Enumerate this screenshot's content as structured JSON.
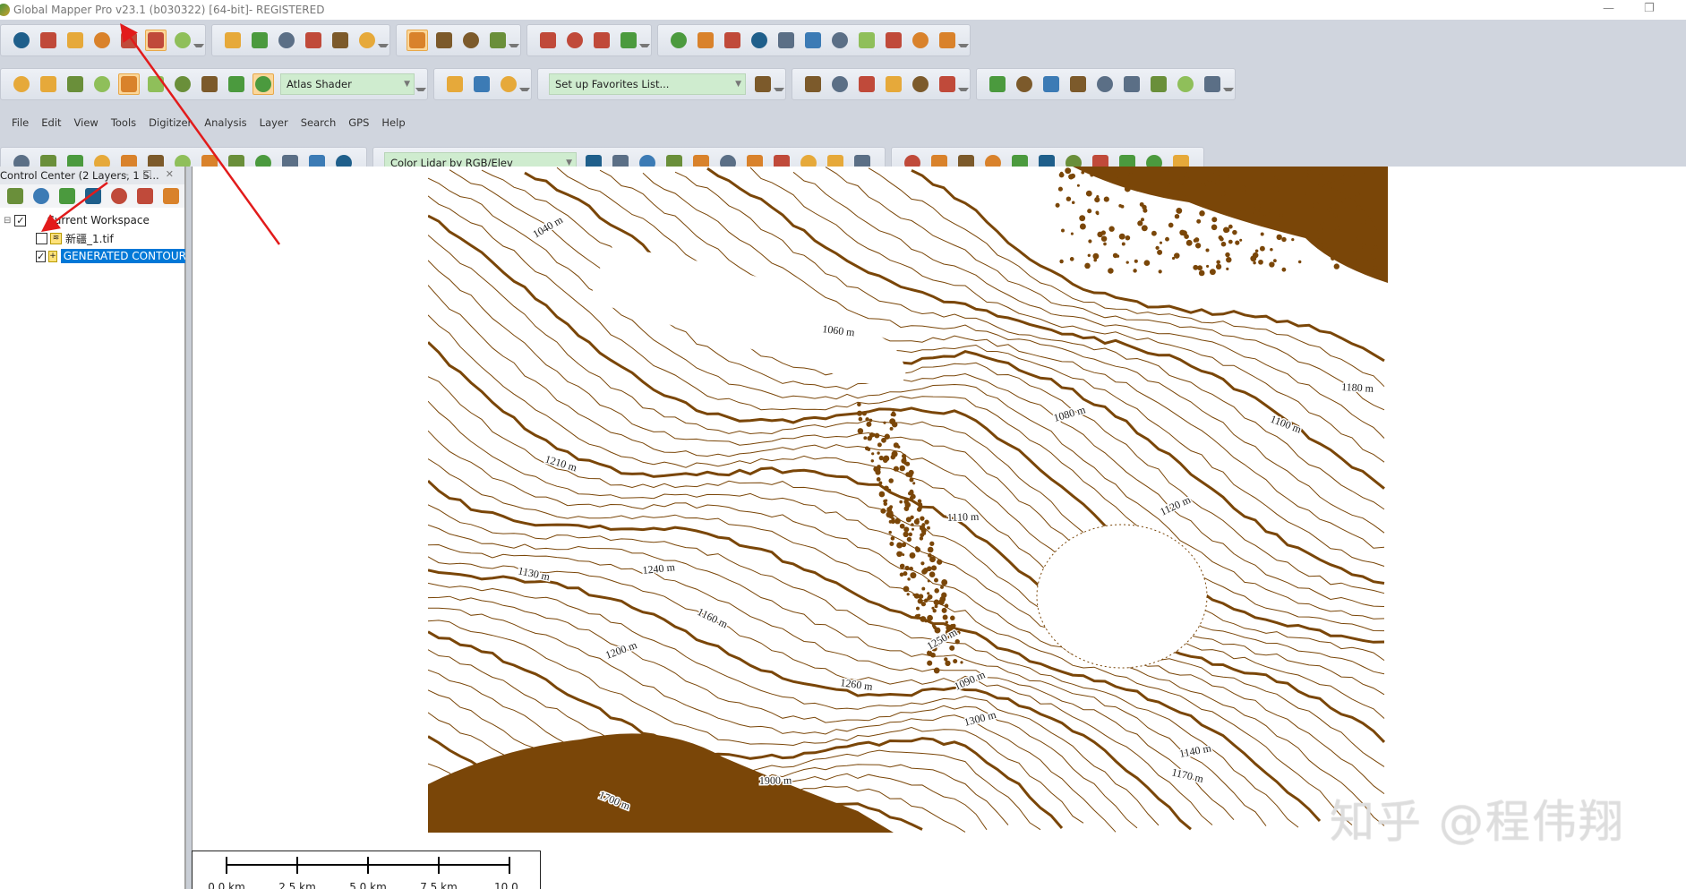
{
  "window": {
    "title": "Global Mapper Pro v23.1 (b030322) [64-bit]- REGISTERED",
    "minimize": "—",
    "restore": "❐"
  },
  "toolbars": {
    "row1": [
      [
        "open-folder",
        "globe",
        "save",
        "config",
        "wrench",
        "layer-control",
        "overview"
      ],
      [
        "zoom-rect",
        "pan-hand",
        "zoom-in",
        "zoom-out",
        "back-arrow",
        "home"
      ],
      [
        "digitizer-pencil",
        "select-rect",
        "delete-x",
        "select-area"
      ],
      [
        "measure",
        "info",
        "search-attr",
        "feature-info"
      ],
      [
        "terrain-1",
        "terrain-2",
        "terrain-3",
        "terrain-4",
        "view-shed",
        "watershed",
        "cross-section",
        "density-grid",
        "flight-path",
        "slope",
        "path-profile"
      ]
    ],
    "row1_active": [
      "layer-control",
      "digitizer-pencil"
    ],
    "row2": [
      [
        "split-view",
        "3d-path",
        "cut",
        "3d-view",
        "shader-toggle",
        "water-level",
        "water-flood",
        "lidar-filter",
        "sunlight",
        "atlas-mountains"
      ],
      [
        "globe-grid",
        "gear",
        "moon"
      ],
      [
        "favorites-star"
      ],
      [
        "draw-points",
        "draw-line",
        "draw-curve",
        "draw-area",
        "draw-rect",
        "draw-circle"
      ],
      [
        "coord-pencil",
        "range-ring",
        "grid-pencil",
        "snap",
        "split-pencil",
        "edit-area",
        "merge-areas",
        "check",
        "spatial-op"
      ]
    ],
    "row2_active": [
      "shader-toggle",
      "atlas-mountains"
    ],
    "shader_dropdown": "Atlas Shader",
    "favorites_dropdown": "Set up Favorites List...",
    "row4": [
      [
        "move",
        "resize",
        "vertex",
        "move-vertex",
        "delete-vertex",
        "add-line",
        "cut-line",
        "join",
        "split",
        "merge",
        "copy",
        "crop",
        "ruler"
      ],
      [
        "lidar-filter",
        "lidar-points",
        "lidar-search",
        "lidar-query",
        "thin",
        "eyedropper",
        "triangle",
        "classify",
        "cluster",
        "mesh",
        "noise"
      ],
      [
        "ground",
        "vegetation",
        "shrub",
        "tree",
        "building",
        "pole",
        "powerline",
        "water",
        "points",
        "key",
        "separate"
      ]
    ],
    "lidar_dropdown": "Color Lidar by RGB/Elev",
    "row5": [
      [
        "settings-points",
        "settings-terrain",
        "settings-buildings",
        "settings-poles",
        "settings-area",
        "puzzle",
        "paint"
      ],
      [
        "play",
        "stop",
        "slow",
        "fast",
        "add-layer",
        "remove-layer"
      ],
      [
        "pie-chart"
      ]
    ]
  },
  "menu": [
    "File",
    "Edit",
    "View",
    "Tools",
    "Digitizer",
    "Analysis",
    "Layer",
    "Search",
    "GPS",
    "Help"
  ],
  "control_center": {
    "title": "Control Center (2 Layers, 1 S...",
    "header_buttons": "– ☐ ✕",
    "tools": [
      "layer-options",
      "metadata",
      "attributes",
      "bounds",
      "zoom-layer",
      "toggle-visibility",
      "close-layer"
    ],
    "workspace": {
      "label": "Current Workspace",
      "checked": true
    },
    "layers": [
      {
        "name": "新疆_1.tif",
        "checked": false,
        "selected": false,
        "icon": "raster-icon"
      },
      {
        "name": "GENERATED CONTOURS",
        "checked": true,
        "selected": true,
        "icon": "vector-icon"
      }
    ]
  },
  "map": {
    "contour_color": "#7a4608",
    "labels": [
      "1040 m",
      "1060 m",
      "1080 m",
      "1100 m",
      "1110 m",
      "1120 m",
      "1130 m",
      "1140 m",
      "1160 m",
      "1180 m",
      "1200 m",
      "1210 m",
      "1240 m",
      "1250 m",
      "1260 m",
      "1300 m",
      "1700 m",
      "1900 m",
      "1090 m",
      "1170 m"
    ]
  },
  "scale_bar": {
    "labels": [
      "0.0 km",
      "2.5 km",
      "5.0 km",
      "7.5 km",
      "10.0 km"
    ]
  },
  "watermark": "知乎 @程伟翔",
  "annotation_color": "#e21b1b"
}
